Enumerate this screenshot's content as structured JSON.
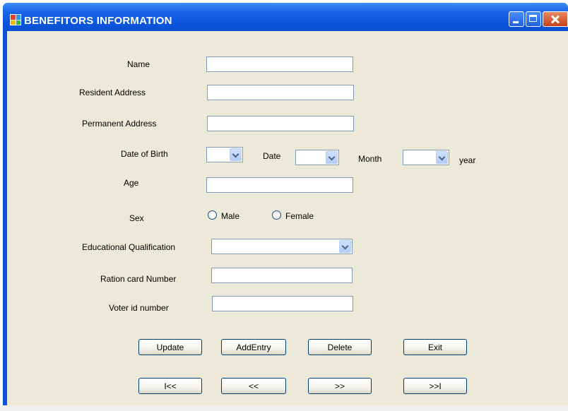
{
  "window": {
    "title": "BENEFITORS INFORMATION"
  },
  "form": {
    "name_label": "Name",
    "resident_address_label": "Resident Address",
    "permanent_address_label": "Permanent Address",
    "dob_label": "Date of Birth",
    "date_label": "Date",
    "month_label": "Month",
    "year_label": "year",
    "age_label": "Age",
    "sex_label": "Sex",
    "male_label": "Male",
    "female_label": "Female",
    "education_label": "Educational Qualification",
    "ration_card_label": "Ration card Number",
    "voter_id_label": "Voter id number",
    "name_value": "",
    "resident_address_value": "",
    "permanent_address_value": "",
    "age_value": "",
    "ration_card_value": "",
    "voter_id_value": ""
  },
  "buttons": {
    "update": "Update",
    "add_entry": "AddEntry",
    "delete": "Delete",
    "exit": "Exit",
    "first": "I<<",
    "previous": "<<",
    "next": ">>",
    "last": ">>I"
  },
  "icons": {
    "app": "app-icon",
    "minimize": "minimize-icon",
    "maximize": "maximize-icon",
    "close": "close-icon"
  }
}
